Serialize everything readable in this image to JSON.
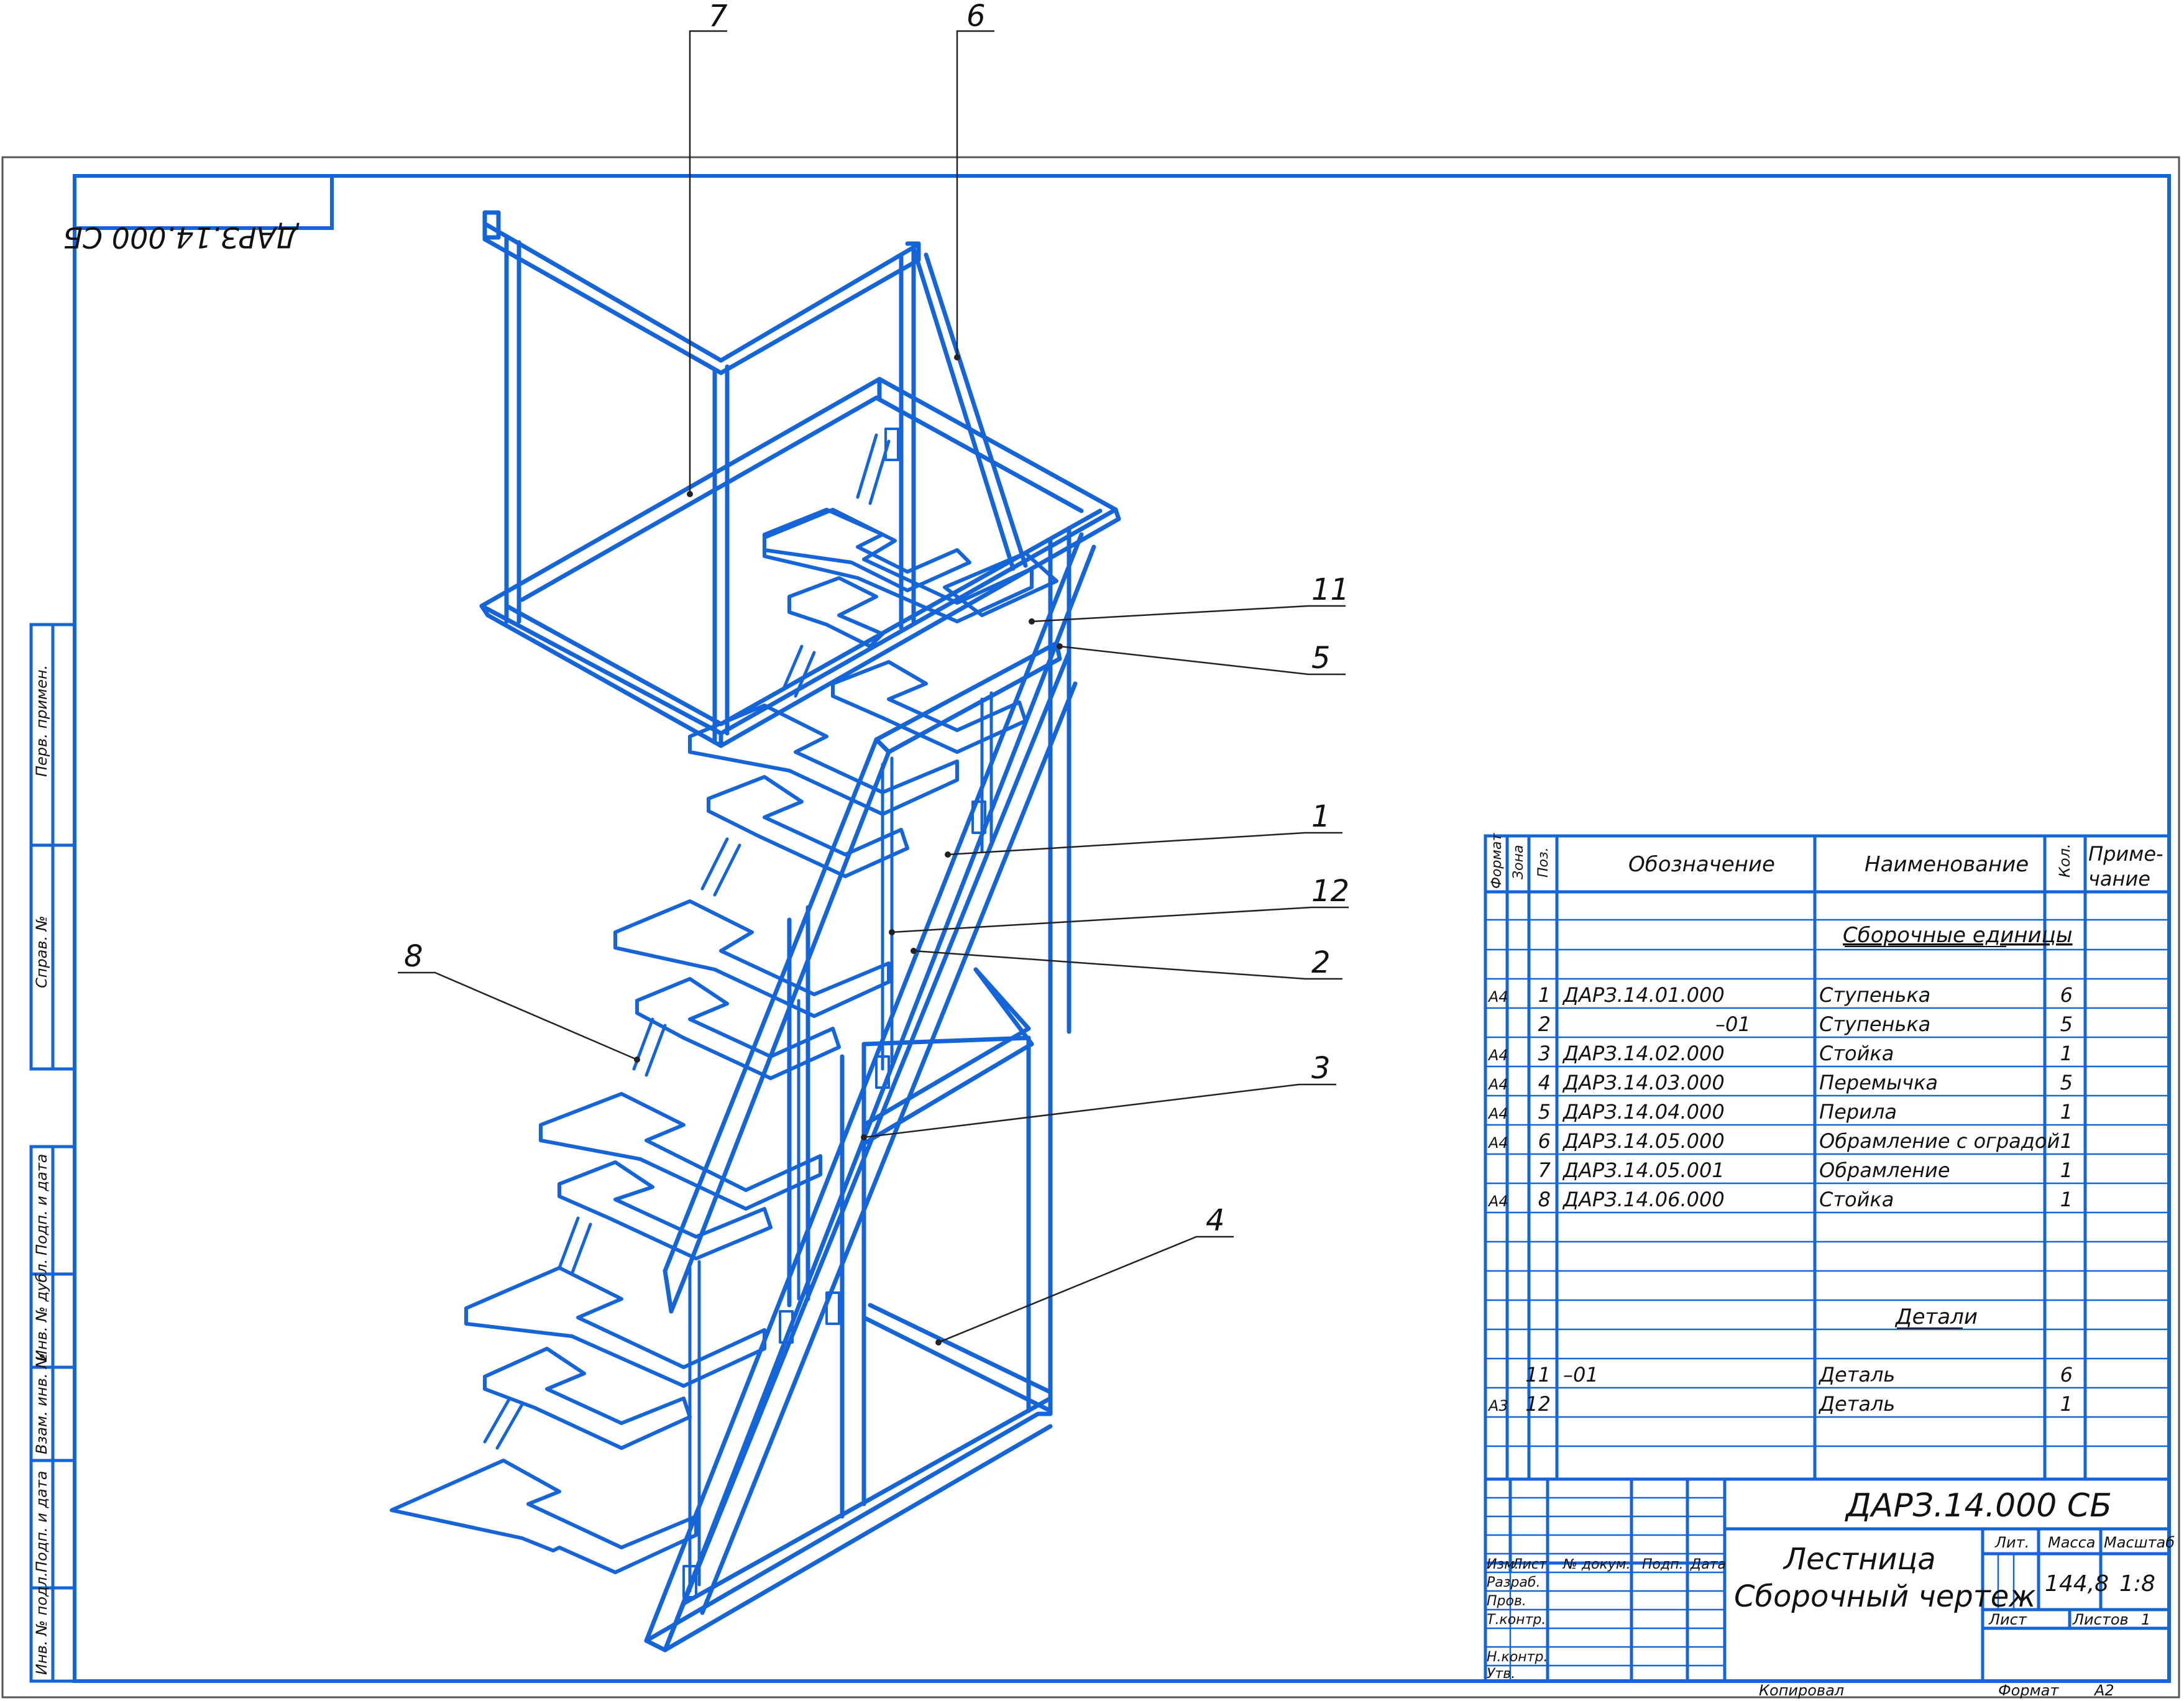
{
  "mirror_code": "ДАРЗ.14.000 СБ",
  "side_labels": [
    "Перв. примен.",
    "Справ. №",
    "Подп. и дата",
    "Инв. № дубл.",
    "Взам. инв. №",
    "Подп. и дата",
    "Инв. № подл."
  ],
  "callouts": [
    "7",
    "6",
    "11",
    "5",
    "1",
    "12",
    "2",
    "8",
    "3",
    "4"
  ],
  "spec": {
    "headers": {
      "format": "Формат",
      "zone": "Зона",
      "pos": "Поз.",
      "designation": "Обозначение",
      "name": "Наименование",
      "qty": "Кол.",
      "note": "Приме- чание"
    },
    "section_assemblies": "Сборочные единицы",
    "section_details": "Детали",
    "rows": [
      {
        "format": "А4",
        "pos": "1",
        "designation": "ДАРЗ.14.01.000",
        "name": "Ступенька",
        "qty": "6"
      },
      {
        "format": "",
        "pos": "2",
        "designation": "–01",
        "name": "Ступенька",
        "qty": "5"
      },
      {
        "format": "А4",
        "pos": "3",
        "designation": "ДАРЗ.14.02.000",
        "name": "Стойка",
        "qty": "1"
      },
      {
        "format": "А4",
        "pos": "4",
        "designation": "ДАРЗ.14.03.000",
        "name": "Перемычка",
        "qty": "5"
      },
      {
        "format": "А4",
        "pos": "5",
        "designation": "ДАРЗ.14.04.000",
        "name": "Перила",
        "qty": "1"
      },
      {
        "format": "А4",
        "pos": "6",
        "designation": "ДАРЗ.14.05.000",
        "name": "Обрамление с оградой",
        "qty": "1"
      },
      {
        "format": "",
        "pos": "7",
        "designation": "ДАРЗ.14.05.001",
        "name": "Обрамление",
        "qty": "1"
      },
      {
        "format": "А4",
        "pos": "8",
        "designation": "ДАРЗ.14.06.000",
        "name": "Стойка",
        "qty": "1"
      }
    ],
    "detail_rows": [
      {
        "format": "",
        "pos": "11",
        "designation": "–01",
        "name": "Деталь",
        "qty": "6"
      },
      {
        "format": "А3",
        "pos": "12",
        "designation": "",
        "name": "Деталь",
        "qty": "1"
      }
    ]
  },
  "title_block": {
    "code": "ДАРЗ.14.000 СБ",
    "title_line1": "Лестница",
    "title_line2": "Сборочный чертеж",
    "col_izm": "Изм.",
    "col_list": "Лист",
    "col_doc": "№ докум.",
    "col_sign": "Подп.",
    "col_date": "Дата",
    "roles": [
      "Разраб.",
      "Пров.",
      "Т.контр.",
      "",
      "Н.контр.",
      "Утв."
    ],
    "lit_label": "Лит.",
    "mass_label": "Масса",
    "scale_label": "Масштаб",
    "mass": "144,8",
    "scale": "1:8",
    "sheet_label": "Лист",
    "sheets_label": "Листов",
    "sheets": "1"
  },
  "footer": {
    "copied": "Копировал",
    "format_label": "Формат",
    "format": "А2"
  }
}
